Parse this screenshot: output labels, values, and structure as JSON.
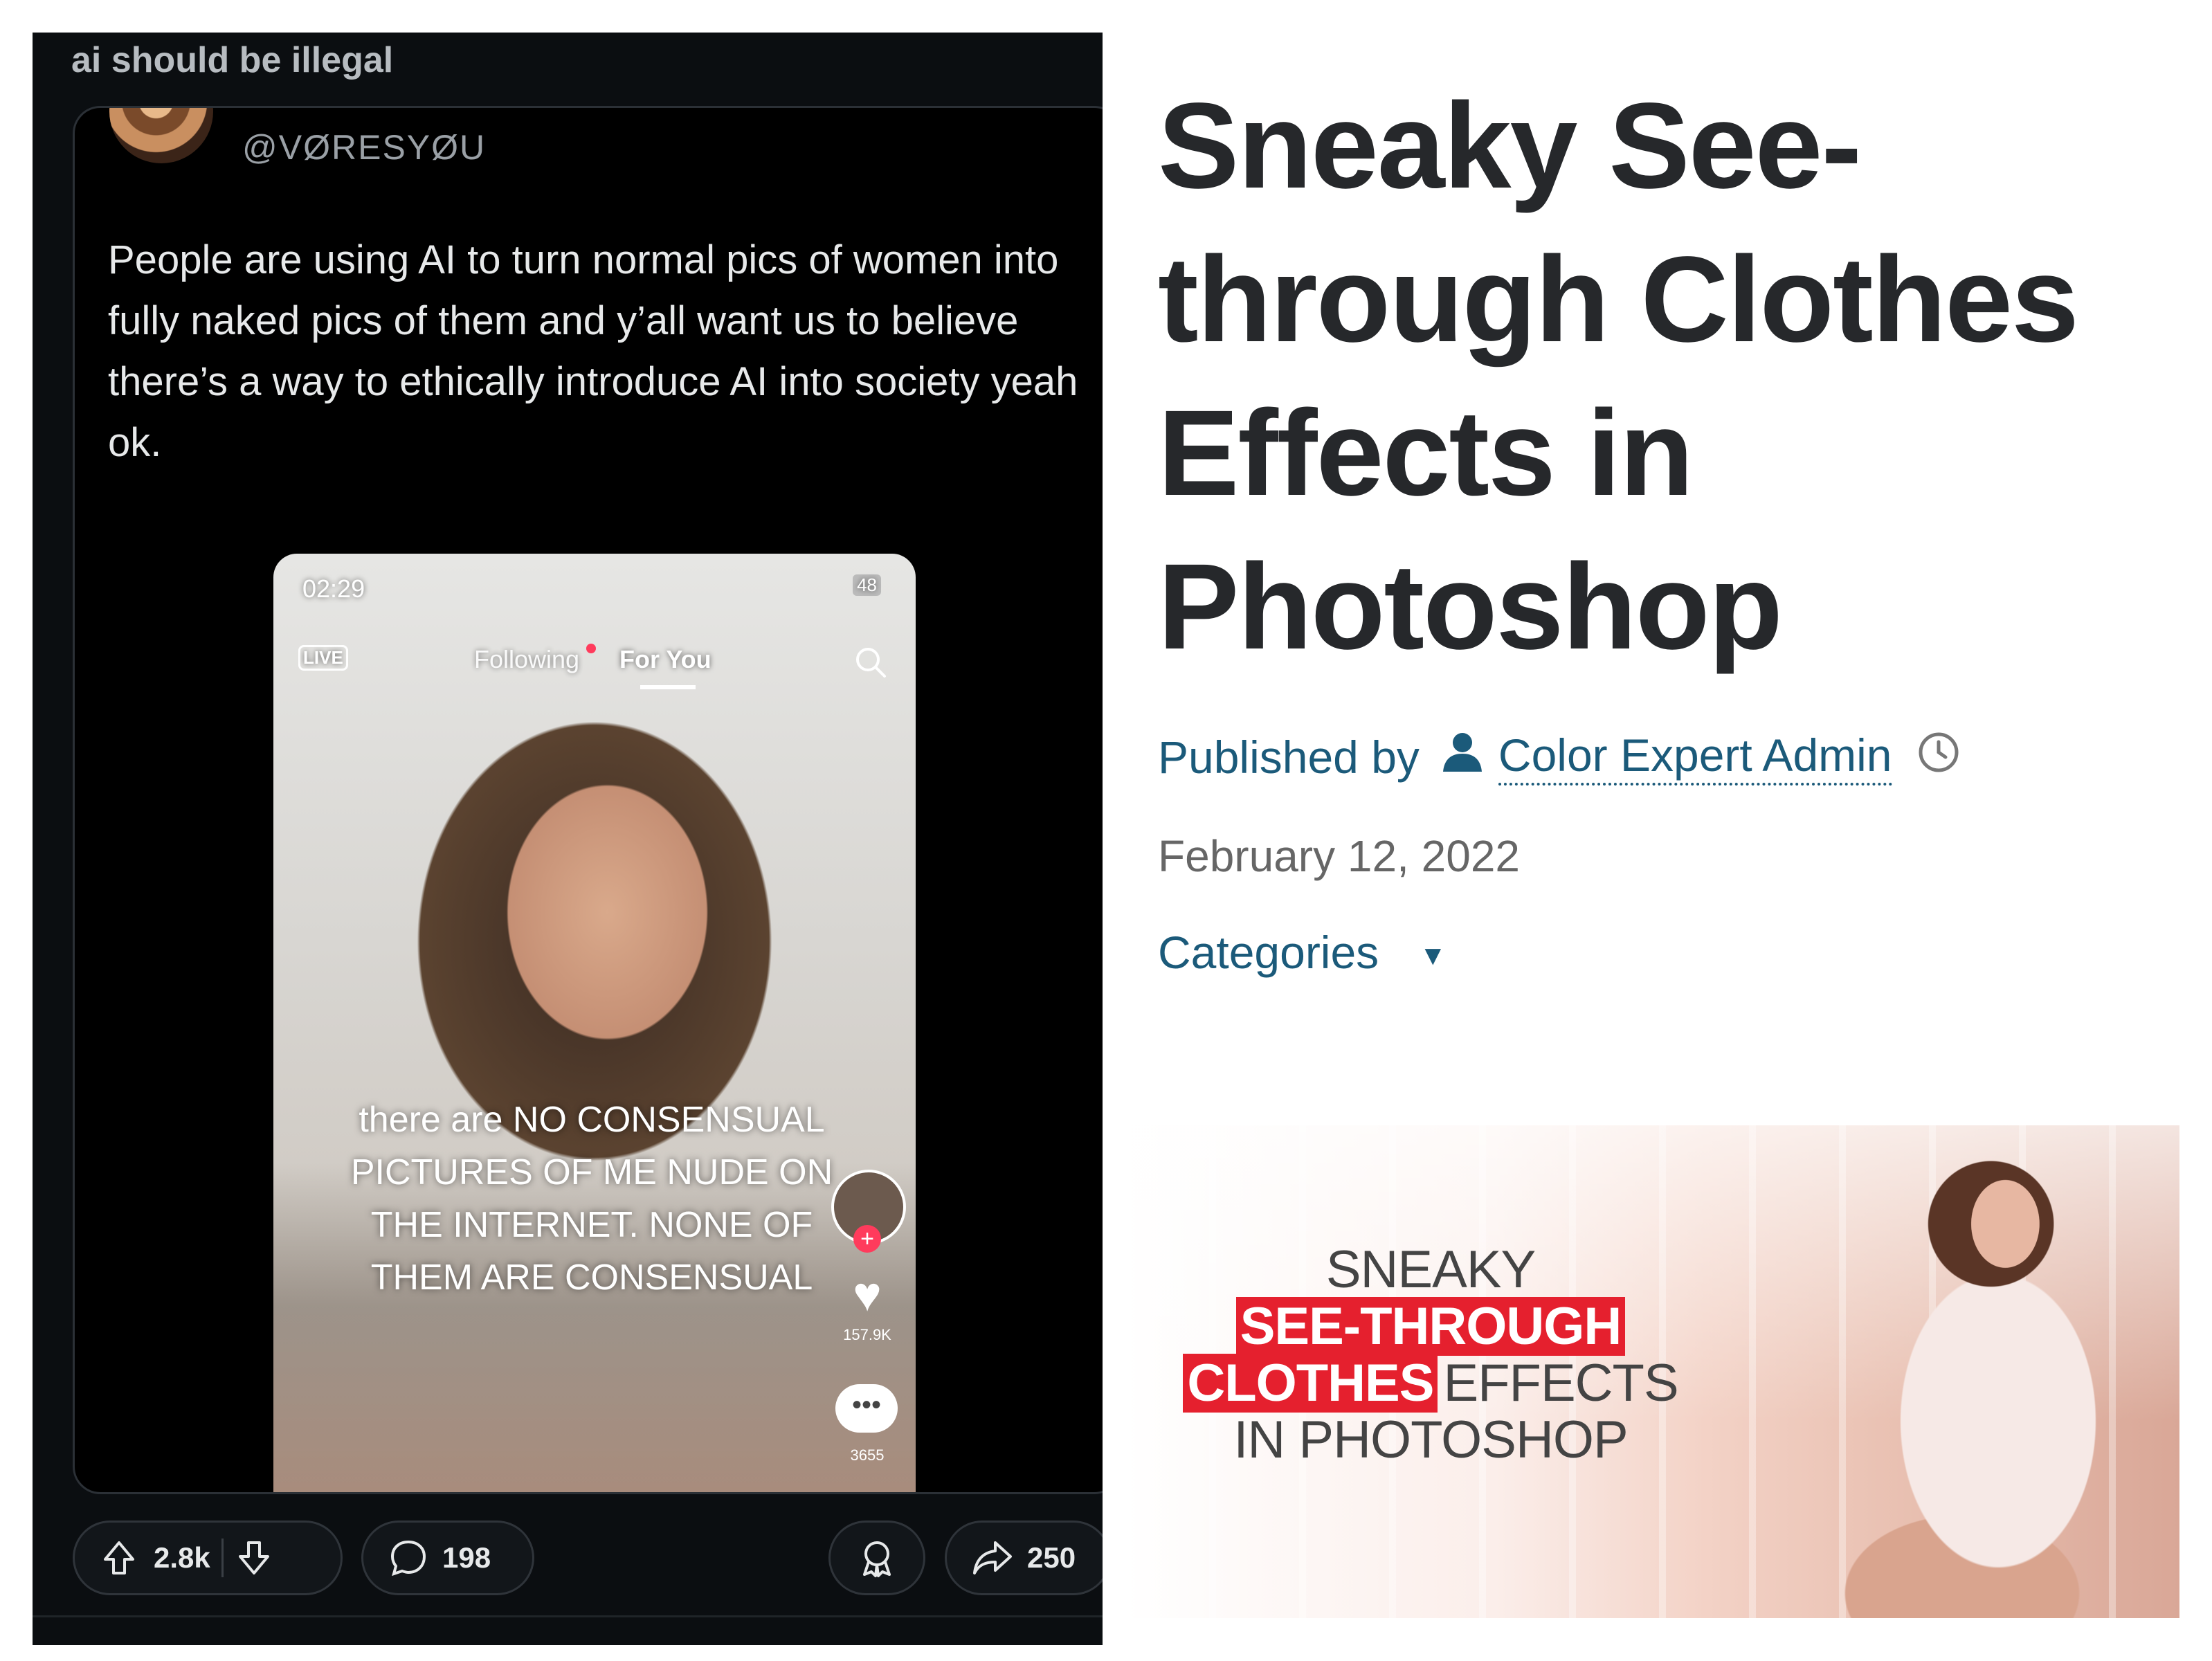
{
  "post": {
    "subreddit_title": "ai should be illegal",
    "handle": "@VØRESYØU",
    "tweet_text": "People are using AI to turn normal pics of women into fully naked pics of them and y’all want us to believe there’s a way to ethically introduce AI into society yeah ok.",
    "phone": {
      "time": "02:29",
      "battery": "48",
      "live_label": "LIVE",
      "tab_following": "Following",
      "tab_for_you": "For You",
      "caption": "there are NO CONSENSUAL PICTURES OF ME NUDE ON THE INTERNET. NONE OF THEM ARE CONSENSUAL",
      "likes": "157.9K",
      "comments": "3655"
    },
    "actions": {
      "upvotes": "2.8k",
      "comments": "198",
      "shares": "250"
    }
  },
  "article": {
    "title": "Sneaky See-through Clothes Effects in Photoshop",
    "published_by": "Published by",
    "author": "Color Expert Admin",
    "date": "February 12, 2022",
    "categories": "Categories",
    "promo": {
      "line1": "SNEAKY",
      "line2": "SEE-THROUGH",
      "line3_red": "CLOTHES",
      "line3_rest": "EFFECTS",
      "line4": "IN PHOTOSHOP"
    }
  },
  "colors": {
    "link": "#1b5a7a",
    "promo_red": "#e5202e",
    "dark_bg": "#0b0e11"
  },
  "icons": [
    "upvote-icon",
    "downvote-icon",
    "comment-icon",
    "award-icon",
    "share-icon",
    "person-icon",
    "clock-icon",
    "dropdown-triangle-icon",
    "search-icon",
    "heart-icon"
  ]
}
